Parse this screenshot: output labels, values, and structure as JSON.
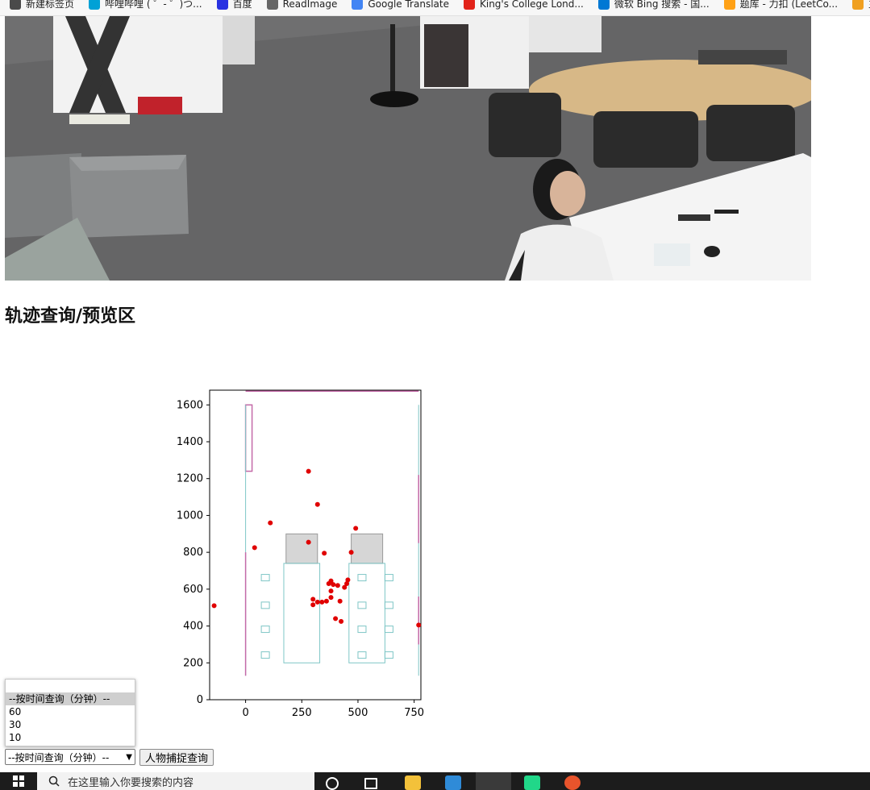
{
  "bookmarks": [
    {
      "label": "新建标签页",
      "color": "#4a4a4a"
    },
    {
      "label": "哔哩哔哩 ( ゜- ゜)つ...",
      "color": "#00a1d6"
    },
    {
      "label": "百度",
      "color": "#2932e1"
    },
    {
      "label": "ReadImage",
      "color": "#666666"
    },
    {
      "label": "Google Translate",
      "color": "#4285f4"
    },
    {
      "label": "King's College Lond...",
      "color": "#e2231a"
    },
    {
      "label": "微软 Bing 搜索 - 国...",
      "color": "#0078d4"
    },
    {
      "label": "题库 - 力扣 (LeetCo...",
      "color": "#ffa116"
    },
    {
      "label": "主播排...",
      "color": "#f0a020"
    }
  ],
  "section_title": "轨迹查询/预览区",
  "dropdown": {
    "options": [
      "--按时间查询（分钟）--",
      "60",
      "30",
      "10"
    ],
    "selected": "--按时间查询（分钟）--"
  },
  "capture_button": "人物捕捉查询",
  "taskbar": {
    "search_placeholder": "在这里输入你要搜索的内容"
  },
  "chart_data": {
    "type": "scatter",
    "title": "",
    "xlabel": "",
    "ylabel": "",
    "xlim": [
      -160,
      780
    ],
    "ylim": [
      0,
      1680
    ],
    "xticks": [
      0,
      250,
      500,
      750
    ],
    "yticks": [
      0,
      200,
      400,
      600,
      800,
      1000,
      1200,
      1400,
      1600
    ],
    "point_color": "#e00000",
    "points": [
      [
        -140,
        510
      ],
      [
        40,
        825
      ],
      [
        110,
        960
      ],
      [
        280,
        1240
      ],
      [
        320,
        1060
      ],
      [
        280,
        855
      ],
      [
        350,
        795
      ],
      [
        470,
        800
      ],
      [
        490,
        930
      ],
      [
        370,
        630
      ],
      [
        380,
        645
      ],
      [
        390,
        625
      ],
      [
        410,
        620
      ],
      [
        450,
        630
      ],
      [
        455,
        650
      ],
      [
        380,
        590
      ],
      [
        300,
        545
      ],
      [
        320,
        530
      ],
      [
        340,
        530
      ],
      [
        360,
        535
      ],
      [
        380,
        555
      ],
      [
        300,
        515
      ],
      [
        420,
        535
      ],
      [
        440,
        610
      ],
      [
        400,
        440
      ],
      [
        425,
        425
      ],
      [
        770,
        405
      ]
    ]
  }
}
